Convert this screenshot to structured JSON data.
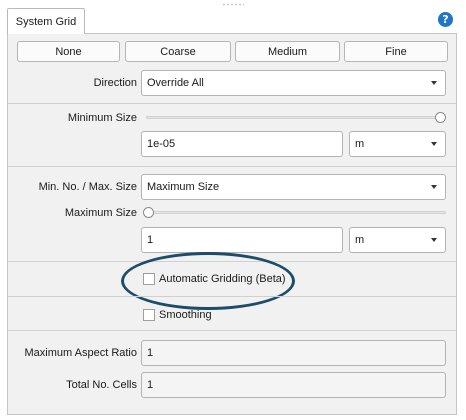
{
  "tab": {
    "label": "System Grid"
  },
  "help_icon": "?",
  "presets": [
    "None",
    "Coarse",
    "Medium",
    "Fine"
  ],
  "direction": {
    "label": "Direction",
    "value": "Override All"
  },
  "minimum_size": {
    "label": "Minimum Size",
    "slider_fraction": 1.0,
    "value": "1e-05",
    "unit": "m"
  },
  "min_max_mode": {
    "label": "Min. No. / Max. Size",
    "value": "Maximum Size"
  },
  "maximum_size": {
    "label": "Maximum Size",
    "slider_fraction": 0.0,
    "value": "1",
    "unit": "m"
  },
  "automatic_gridding": {
    "label": "Automatic Gridding (Beta)",
    "checked": false
  },
  "smoothing": {
    "label": "Smoothing",
    "checked": false
  },
  "max_aspect_ratio": {
    "label": "Maximum Aspect Ratio",
    "value": "1"
  },
  "total_cells": {
    "label": "Total No. Cells",
    "value": "1"
  },
  "colors": {
    "accent": "#1e76c9",
    "highlight_ellipse": "#1d4d68"
  }
}
